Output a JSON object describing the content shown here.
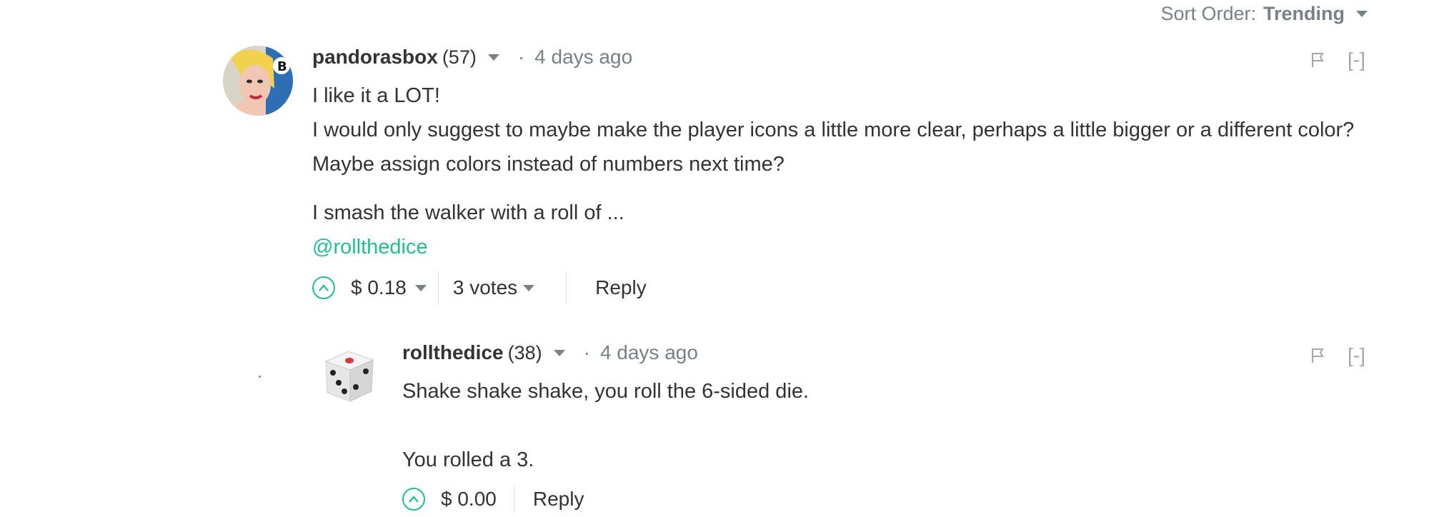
{
  "sort": {
    "label": "Sort Order:",
    "value": "Trending"
  },
  "comments": [
    {
      "author": "pandorasbox",
      "reputation": "(57)",
      "time": "4 days ago",
      "paragraphs": [
        "I like it a LOT!",
        "I would only suggest to maybe make the player icons a little more clear, perhaps a little bigger or a different color? Maybe assign colors instead of numbers next time?",
        "I smash the walker with a roll of ...",
        "@rollthedice"
      ],
      "payout": "$ 0.18",
      "votes": "3 votes",
      "reply_label": "Reply",
      "collapse_label": "[-]"
    },
    {
      "author": "rollthedice",
      "reputation": "(38)",
      "time": "4 days ago",
      "paragraphs": [
        "Shake shake shake, you roll the 6-sided die.",
        "You rolled a 3."
      ],
      "payout": "$ 0.00",
      "reply_label": "Reply",
      "collapse_label": "[-]"
    }
  ],
  "colors": {
    "accent": "#1fbf8f",
    "muted": "#788187",
    "text": "#333333"
  }
}
